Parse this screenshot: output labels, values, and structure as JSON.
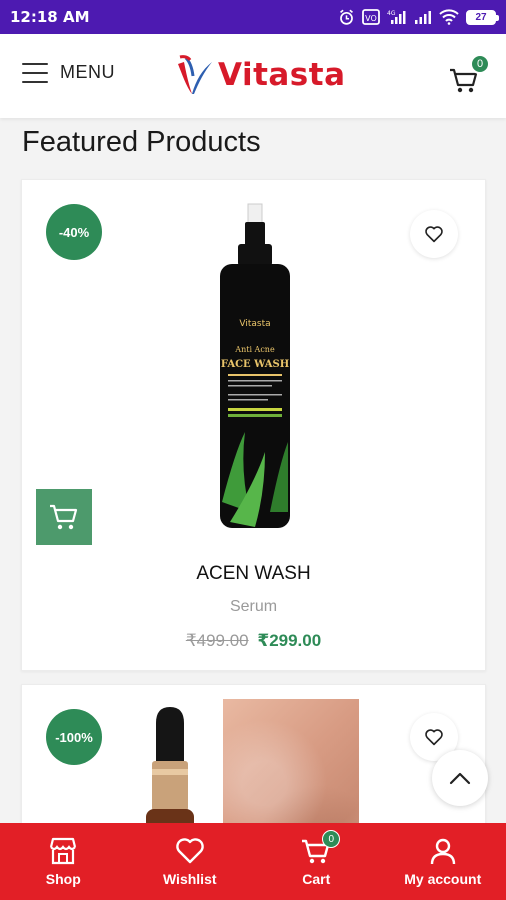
{
  "status_bar": {
    "time": "12:18 AM",
    "battery": "27"
  },
  "header": {
    "menu_label": "MENU",
    "logo_text": "Vitasta",
    "cart_count": "0"
  },
  "section": {
    "title": "Featured Products"
  },
  "products": [
    {
      "discount": "-40%",
      "name": "ACEN WASH",
      "category": "Serum",
      "old_price": "₹499.00",
      "new_price": "₹299.00",
      "bottle_brand": "Vitasta",
      "bottle_line1": "Anti Acne",
      "bottle_line2": "FACE WASH"
    },
    {
      "discount": "-100%"
    }
  ],
  "bottom_nav": {
    "items": [
      {
        "label": "Shop",
        "icon": "store-icon"
      },
      {
        "label": "Wishlist",
        "icon": "heart-icon"
      },
      {
        "label": "Cart",
        "icon": "cart-icon",
        "badge": "0"
      },
      {
        "label": "My account",
        "icon": "user-icon"
      }
    ]
  },
  "colors": {
    "status_bar": "#4d1ab1",
    "brand_red": "#e21f26",
    "discount_green": "#2e8b57",
    "price_green": "#2e8b57"
  }
}
